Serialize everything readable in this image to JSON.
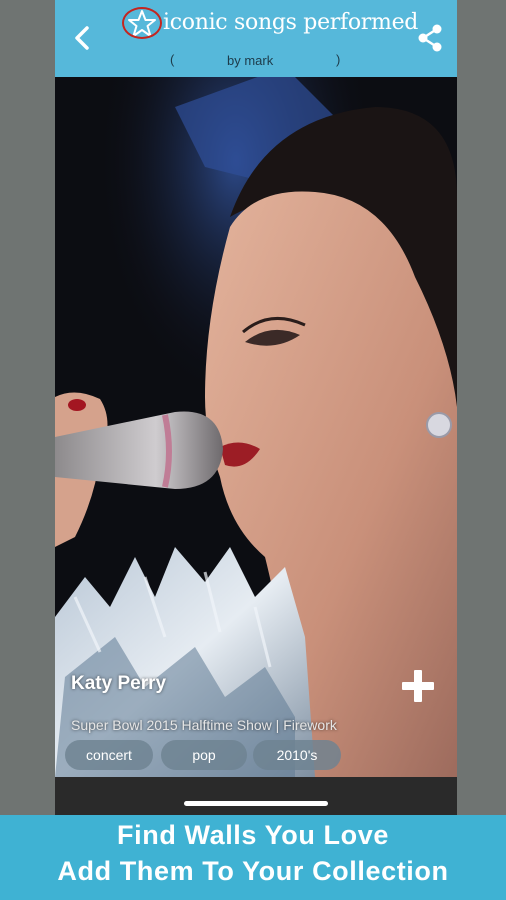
{
  "header": {
    "back_icon": "chevron-left-icon",
    "favorite_icon": "star-icon",
    "title": "iconic songs performed",
    "paren_open": "(",
    "byline": "by mark",
    "paren_close": ")",
    "share_icon": "share-icon",
    "background_color": "#56b8da"
  },
  "wallpaper": {
    "artist": "Katy Perry",
    "caption": "Super Bowl 2015 Halftime Show | Firework",
    "add_icon": "plus-icon",
    "tags": [
      "concert",
      "pop",
      "2010's"
    ]
  },
  "promo": {
    "line1": "Find Walls You Love",
    "line2": "Add Them To Your Collection",
    "background_color": "#3fb2d3"
  }
}
